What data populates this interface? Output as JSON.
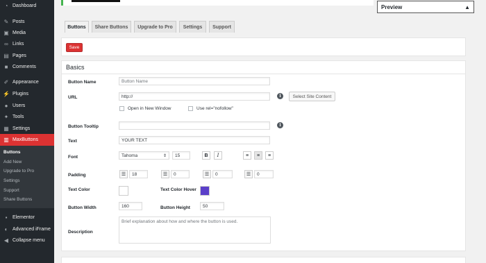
{
  "sidebar": {
    "items": [
      {
        "label": "Dashboard",
        "icon": "dashboard-icon"
      },
      {
        "label": "Posts",
        "icon": "pin-icon"
      },
      {
        "label": "Media",
        "icon": "media-icon"
      },
      {
        "label": "Links",
        "icon": "links-icon"
      },
      {
        "label": "Pages",
        "icon": "pages-icon"
      },
      {
        "label": "Comments",
        "icon": "comments-icon"
      },
      {
        "label": "Appearance",
        "icon": "appearance-icon"
      },
      {
        "label": "Plugins",
        "icon": "plugins-icon"
      },
      {
        "label": "Users",
        "icon": "users-icon"
      },
      {
        "label": "Tools",
        "icon": "tools-icon"
      },
      {
        "label": "Settings",
        "icon": "settings-icon"
      },
      {
        "label": "MaxButtons",
        "icon": "maxbuttons-icon"
      },
      {
        "label": "Elementor",
        "icon": "elementor-icon"
      },
      {
        "label": "Advanced iFrame",
        "icon": "iframe-icon"
      },
      {
        "label": "Collapse menu",
        "icon": "collapse-icon"
      }
    ],
    "submenu": [
      "Buttons",
      "Add New",
      "Upgrade to Pro",
      "Settings",
      "Support",
      "Share Buttons"
    ]
  },
  "preview": {
    "title": "Preview",
    "arrow": "▲"
  },
  "tabs": [
    "Buttons",
    "Share Buttons",
    "Upgrade to Pro",
    "Settings",
    "Support"
  ],
  "save_label": "Save",
  "basics": {
    "title": "Basics",
    "labels": {
      "button_name": "Button Name",
      "url": "URL",
      "tooltip": "Button Tooltip",
      "text": "Text",
      "font": "Font",
      "padding": "Padding",
      "text_color": "Text Color",
      "text_color_hover": "Text Color Hover",
      "button_width": "Button Width",
      "button_height": "Button Height",
      "description": "Description"
    },
    "button_name_placeholder": "Button Name",
    "url_value": "http://",
    "select_site_content": "Select Site Content",
    "open_new_window": "Open in New Window",
    "use_nofollow": "Use rel=\"nofollow\"",
    "tooltip_value": "",
    "text_value": "YOUR TEXT",
    "font_family": "Tahoma",
    "font_size": "15",
    "bold_glyph": "B",
    "italic_glyph": "I",
    "padding": [
      "18",
      "0",
      "0",
      "0"
    ],
    "text_color": "#ffffff",
    "text_color_hover": "#5b3fc9",
    "button_width": "160",
    "button_height": "50",
    "description_placeholder": "Brief explanation about how and where the button is used."
  },
  "colors": {
    "accent": "#dc3232",
    "sidebar": "#23282d",
    "notice_green": "#46b450"
  }
}
